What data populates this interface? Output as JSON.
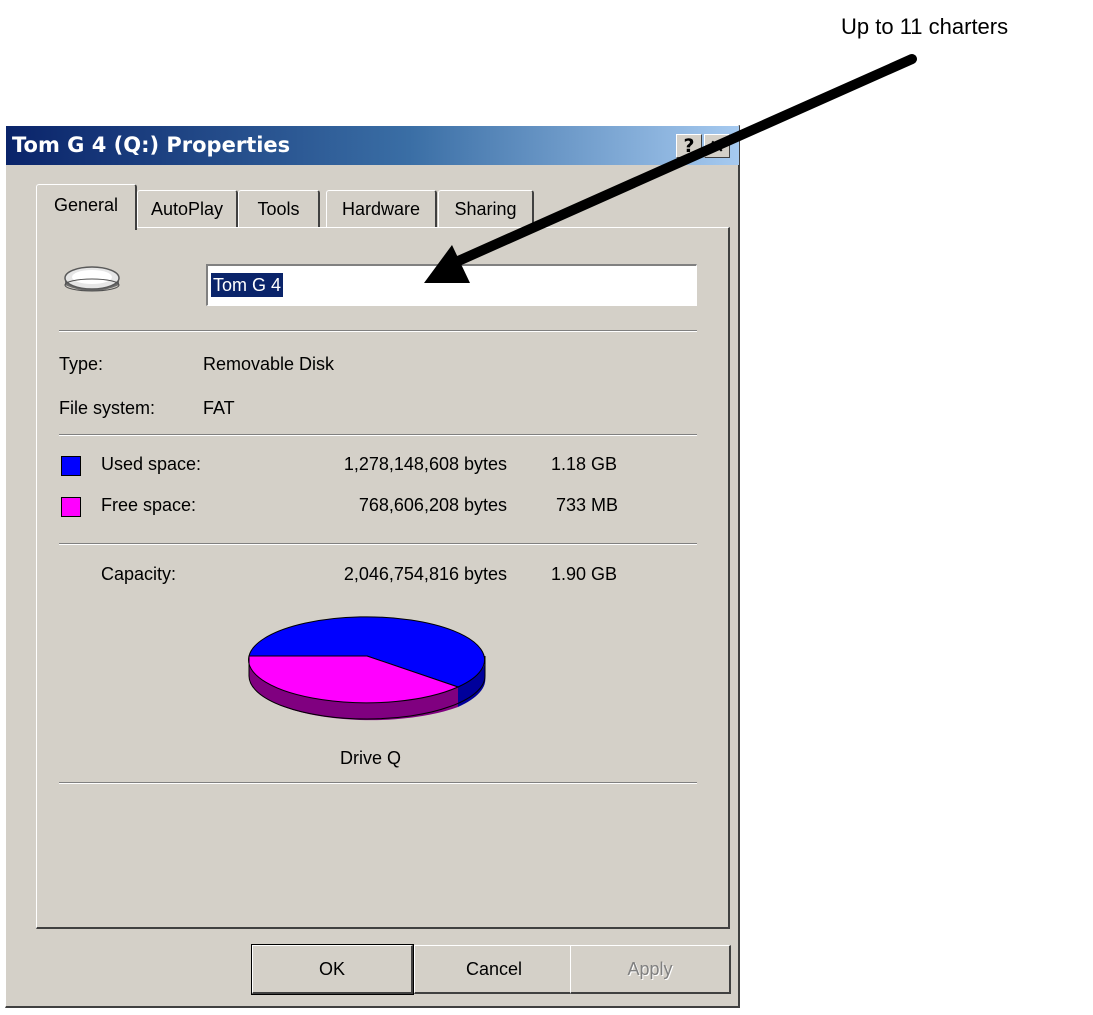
{
  "annotation": {
    "text": "Up to 11 charters"
  },
  "window": {
    "title": "Tom G 4 (Q:) Properties",
    "help_label": "?",
    "close_label": "×"
  },
  "tabs": [
    {
      "label": "General",
      "active": true
    },
    {
      "label": "AutoPlay",
      "active": false
    },
    {
      "label": "Tools",
      "active": false
    },
    {
      "label": "Hardware",
      "active": false
    },
    {
      "label": "Sharing",
      "active": false
    }
  ],
  "drive": {
    "icon": "removable-drive-icon",
    "name_value": "Tom G 4"
  },
  "info": {
    "type_label": "Type:",
    "type_value": "Removable Disk",
    "fs_label": "File system:",
    "fs_value": "FAT"
  },
  "space": {
    "used": {
      "label": "Used space:",
      "bytes": "1,278,148,608 bytes",
      "size": "1.18 GB",
      "color": "#0000ff"
    },
    "free": {
      "label": "Free space:",
      "bytes": "768,606,208 bytes",
      "size": "733 MB",
      "color": "#ff00ff"
    },
    "capacity": {
      "label": "Capacity:",
      "bytes": "2,046,754,816 bytes",
      "size": "1.90 GB"
    }
  },
  "pie": {
    "label": "Drive Q",
    "used_fraction": 0.6245
  },
  "buttons": {
    "ok": "OK",
    "cancel": "Cancel",
    "apply": "Apply"
  }
}
